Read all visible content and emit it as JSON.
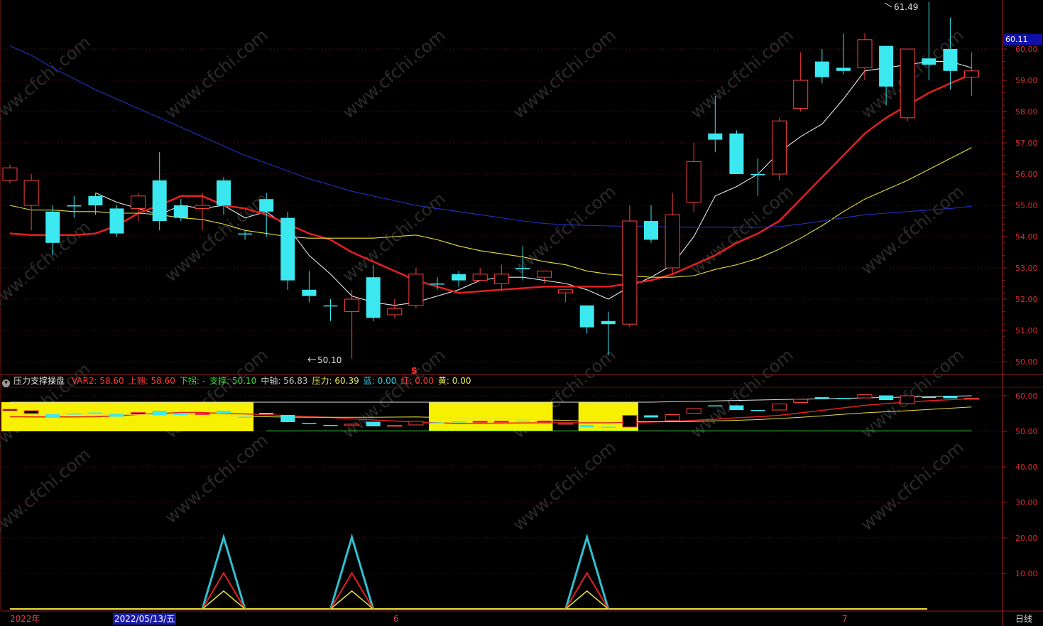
{
  "chart_data": {
    "type": "candlestick",
    "main": {
      "yticks": [
        50,
        51,
        52,
        53,
        54,
        55,
        56,
        57,
        58,
        59,
        60
      ],
      "ylim": [
        49.8,
        61.8
      ],
      "current_price": "60.11",
      "high_label": "61.49",
      "low_label": "50.10",
      "marker": "S",
      "candles": [
        [
          55.8,
          56.2,
          56.3,
          55.7
        ],
        [
          55.0,
          55.8,
          56.0,
          54.2
        ],
        [
          54.8,
          53.8,
          55.0,
          53.4
        ],
        [
          55.0,
          55.0,
          55.3,
          54.6
        ],
        [
          55.3,
          55.0,
          55.4,
          54.7
        ],
        [
          54.9,
          54.1,
          55.0,
          54.0
        ],
        [
          54.9,
          55.3,
          55.4,
          54.5
        ],
        [
          55.8,
          54.5,
          56.7,
          54.2
        ],
        [
          55.0,
          54.6,
          55.2,
          54.5
        ],
        [
          54.9,
          55.0,
          55.4,
          54.2
        ],
        [
          55.8,
          55.0,
          55.9,
          54.7
        ],
        [
          54.1,
          54.1,
          54.2,
          53.9
        ],
        [
          55.2,
          54.8,
          55.4,
          54.0
        ],
        [
          54.6,
          52.6,
          54.8,
          52.3
        ],
        [
          52.3,
          52.1,
          52.9,
          51.9
        ],
        [
          51.8,
          51.8,
          52.0,
          51.3
        ],
        [
          51.6,
          52.0,
          52.3,
          50.1
        ],
        [
          52.7,
          51.4,
          53.1,
          51.3
        ],
        [
          51.5,
          51.7,
          52.0,
          51.4
        ],
        [
          51.8,
          52.8,
          53.0,
          51.7
        ],
        [
          52.5,
          52.5,
          52.7,
          52.3
        ],
        [
          52.8,
          52.6,
          52.9,
          52.4
        ],
        [
          52.6,
          52.8,
          53.0,
          52.6
        ],
        [
          52.5,
          52.8,
          53.1,
          52.3
        ],
        [
          53.0,
          53.0,
          53.7,
          52.6
        ],
        [
          52.7,
          52.9,
          52.9,
          52.5
        ],
        [
          52.2,
          52.3,
          52.3,
          51.9
        ],
        [
          51.8,
          51.1,
          51.8,
          50.9
        ],
        [
          51.3,
          51.2,
          51.6,
          50.2
        ],
        [
          51.2,
          54.5,
          55.0,
          51.1
        ],
        [
          54.5,
          53.9,
          55.0,
          53.8
        ],
        [
          53.0,
          54.7,
          55.4,
          52.8
        ],
        [
          55.1,
          56.4,
          57.0,
          54.8
        ],
        [
          57.3,
          57.1,
          58.5,
          56.7
        ],
        [
          57.3,
          56.0,
          57.4,
          56.0
        ],
        [
          56.0,
          56.0,
          56.5,
          55.3
        ],
        [
          56.0,
          57.7,
          57.8,
          55.8
        ],
        [
          58.1,
          59.0,
          59.9,
          58.0
        ],
        [
          59.6,
          59.1,
          60.0,
          58.9
        ],
        [
          59.4,
          59.3,
          60.5,
          59.2
        ],
        [
          59.4,
          60.3,
          60.5,
          59.0
        ],
        [
          60.1,
          58.8,
          60.1,
          58.2
        ],
        [
          57.8,
          60.0,
          60.0,
          57.7
        ],
        [
          59.7,
          59.5,
          61.5,
          59.0
        ],
        [
          60.0,
          59.3,
          61.0,
          58.7
        ],
        [
          59.1,
          59.3,
          59.9,
          58.5
        ]
      ],
      "ma": [
        {
          "name": "ma-white",
          "color": "#e8e8e8",
          "values": [
            null,
            null,
            null,
            null,
            55.4,
            55.1,
            54.9,
            54.7,
            55.0,
            54.9,
            55.0,
            54.6,
            54.8,
            54.3,
            53.4,
            52.8,
            52.1,
            51.9,
            51.8,
            51.9,
            52.1,
            52.3,
            52.6,
            52.7,
            52.7,
            52.6,
            52.5,
            52.3,
            52.0,
            52.4,
            52.7,
            53.1,
            54.0,
            55.3,
            55.6,
            56.0,
            56.7,
            57.2,
            57.6,
            58.4,
            59.3,
            59.4,
            59.5,
            59.6,
            59.6,
            59.4
          ]
        },
        {
          "name": "ma-red",
          "color": "#e42020",
          "values": [
            54.1,
            54.05,
            54.05,
            54.05,
            54.1,
            54.35,
            54.75,
            55.0,
            55.3,
            55.3,
            55.0,
            54.9,
            54.7,
            54.4,
            54.1,
            53.9,
            53.5,
            53.2,
            52.9,
            52.6,
            52.4,
            52.2,
            52.25,
            52.3,
            52.35,
            52.4,
            52.4,
            52.4,
            52.4,
            52.5,
            52.6,
            52.8,
            53.1,
            53.4,
            53.8,
            54.1,
            54.5,
            55.2,
            55.9,
            56.6,
            57.3,
            57.8,
            58.2,
            58.6,
            58.9,
            59.2
          ]
        },
        {
          "name": "ma-yellow",
          "color": "#e6e03c",
          "values": [
            55.0,
            54.85,
            54.85,
            54.8,
            54.8,
            54.75,
            54.75,
            54.7,
            54.6,
            54.55,
            54.4,
            54.2,
            54.1,
            54.0,
            53.95,
            53.95,
            53.95,
            53.95,
            54.0,
            54.05,
            53.9,
            53.7,
            53.55,
            53.45,
            53.35,
            53.2,
            53.1,
            52.9,
            52.8,
            52.75,
            52.7,
            52.7,
            52.75,
            52.95,
            53.1,
            53.3,
            53.6,
            53.95,
            54.35,
            54.8,
            55.2,
            55.5,
            55.8,
            56.15,
            56.5,
            56.85
          ]
        },
        {
          "name": "ma-blue",
          "color": "#2430c0",
          "values": [
            60.1,
            59.8,
            59.4,
            59.05,
            58.7,
            58.4,
            58.1,
            57.8,
            57.5,
            57.2,
            56.9,
            56.6,
            56.35,
            56.1,
            55.85,
            55.65,
            55.45,
            55.3,
            55.15,
            55.0,
            54.9,
            54.8,
            54.7,
            54.6,
            54.5,
            54.42,
            54.38,
            54.36,
            54.34,
            54.33,
            54.32,
            54.31,
            54.3,
            54.3,
            54.3,
            54.3,
            54.32,
            54.4,
            54.5,
            54.6,
            54.7,
            54.75,
            54.8,
            54.85,
            54.9,
            54.97
          ]
        }
      ]
    },
    "sub": {
      "yticks": [
        10,
        20,
        30,
        40,
        50,
        60
      ],
      "ylim": [
        0,
        66
      ],
      "spikes": [
        10,
        16,
        27
      ],
      "support_level": 50.1
    }
  },
  "indicator": {
    "collapse_icon": "chevron-down-icon",
    "title": "压力支撑操盘",
    "items": [
      {
        "key": "VAR2:",
        "value": "58.60",
        "color": "#ff3b3b"
      },
      {
        "key": "上翘:",
        "value": "58.60",
        "color": "#ff3b3b"
      },
      {
        "key": "下拐:",
        "value": "-",
        "color": "#3cdc3c"
      },
      {
        "key": "支撑:",
        "value": "50.10",
        "color": "#3cdc3c"
      },
      {
        "key": "中轴:",
        "value": "56.83",
        "color": "#c8c8c8"
      },
      {
        "key": "压力:",
        "value": "60.39",
        "color": "#f0f050"
      },
      {
        "key": "蓝:",
        "value": "0.00",
        "color": "#30d0e0"
      },
      {
        "key": "红:",
        "value": "0.00",
        "color": "#ff3b3b"
      },
      {
        "key": "黄:",
        "value": "0.00",
        "color": "#f0f050"
      }
    ]
  },
  "datebar": {
    "year_label": "2022年",
    "cursor_date": "2022/05/13/五",
    "month6": "6",
    "month7": "7"
  },
  "period_button": "日线",
  "watermark": "www.cfchi.com"
}
